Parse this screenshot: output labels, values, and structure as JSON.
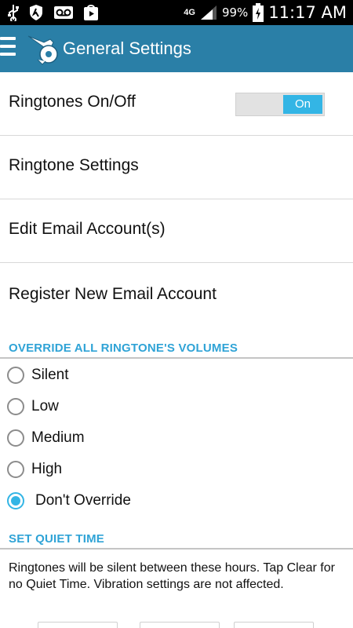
{
  "status_bar": {
    "icons": [
      "usb-icon",
      "shield-icon",
      "voicemail-icon",
      "play-store-icon"
    ],
    "network": "4G",
    "battery": "99%",
    "time": "11:17 AM"
  },
  "action_bar": {
    "title": "General Settings"
  },
  "settings": {
    "ringtones_label": "Ringtones On/Off",
    "ringtones_toggle": "On",
    "ringtone_settings": "Ringtone Settings",
    "edit_email": "Edit Email Account(s)",
    "register_email": "Register New Email Account"
  },
  "override": {
    "header": "OVERRIDE ALL RINGTONE'S VOLUMES",
    "options": [
      "Silent",
      "Low",
      "Medium",
      "High",
      "Don't Override"
    ],
    "selected": "Don't Override"
  },
  "quiet_time": {
    "header": "SET QUIET TIME",
    "description": "Ringtones will be silent between these hours. Tap Clear for no Quiet Time. Vibration settings are not affected."
  },
  "colors": {
    "action_bar": "#2a7fa7",
    "accent": "#33b5e5",
    "section_header": "#2fa3d6"
  }
}
